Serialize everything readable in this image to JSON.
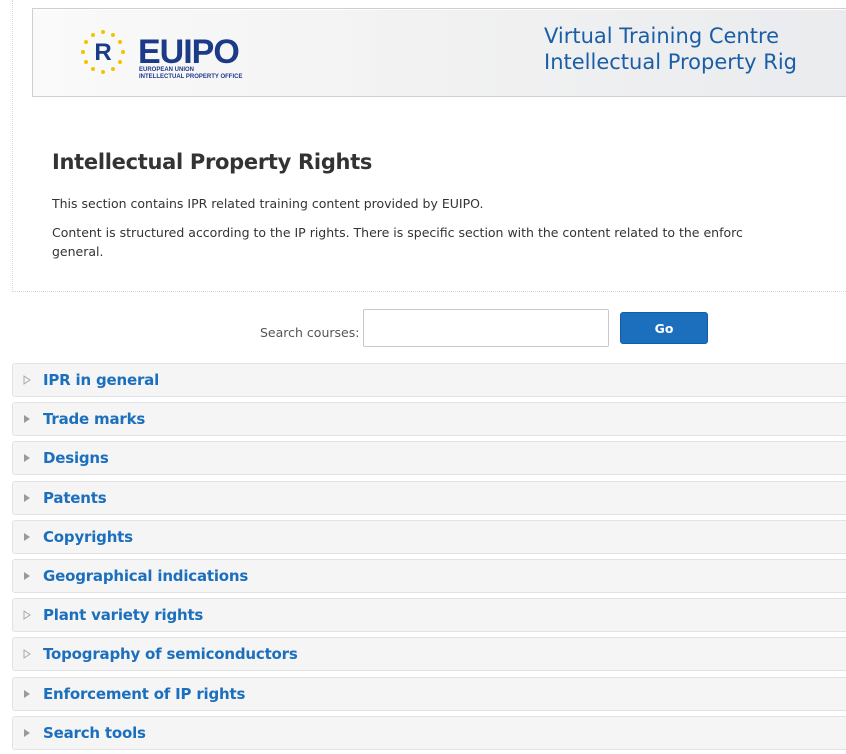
{
  "banner": {
    "logo_word": "EUIPO",
    "logo_subtitle": "EUROPEAN UNION\nINTELLECTUAL PROPERTY OFFICE",
    "title_line1": "Virtual Training Centre",
    "title_line2": "Intellectual Property Rig"
  },
  "intro": {
    "heading": "Intellectual Property Rights",
    "paragraph1": "This section contains IPR related training content provided by EUIPO.",
    "paragraph2": "Content is structured according to the IP rights. There is specific section with the content related to the enforc",
    "paragraph2_cont": "general."
  },
  "search": {
    "label": "Search courses:",
    "value": "",
    "button_label": "Go"
  },
  "categories": [
    {
      "label": "IPR in general",
      "expandable": false
    },
    {
      "label": "Trade marks",
      "expandable": true
    },
    {
      "label": "Designs",
      "expandable": true
    },
    {
      "label": "Patents",
      "expandable": true
    },
    {
      "label": "Copyrights",
      "expandable": true
    },
    {
      "label": "Geographical indications",
      "expandable": true
    },
    {
      "label": "Plant variety rights",
      "expandable": false
    },
    {
      "label": "Topography of semiconductors",
      "expandable": false
    },
    {
      "label": "Enforcement of IP rights",
      "expandable": true
    },
    {
      "label": "Search tools",
      "expandable": true
    }
  ],
  "colors": {
    "link": "#1b6fbd",
    "brand": "#1b3b88",
    "button": "#1b6fbd"
  }
}
